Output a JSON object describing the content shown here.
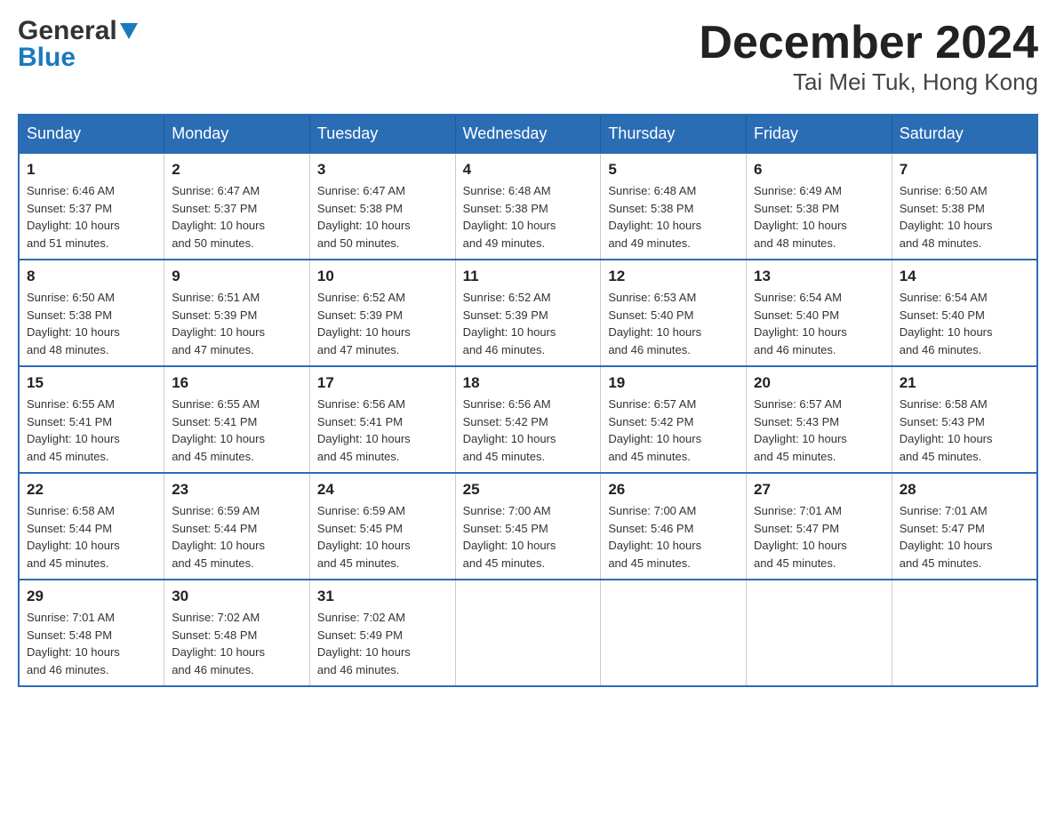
{
  "header": {
    "logo_general": "General",
    "logo_blue": "Blue",
    "month_title": "December 2024",
    "location": "Tai Mei Tuk, Hong Kong"
  },
  "calendar": {
    "days_of_week": [
      "Sunday",
      "Monday",
      "Tuesday",
      "Wednesday",
      "Thursday",
      "Friday",
      "Saturday"
    ],
    "weeks": [
      [
        {
          "day": "1",
          "sunrise": "6:46 AM",
          "sunset": "5:37 PM",
          "daylight": "10 hours and 51 minutes."
        },
        {
          "day": "2",
          "sunrise": "6:47 AM",
          "sunset": "5:37 PM",
          "daylight": "10 hours and 50 minutes."
        },
        {
          "day": "3",
          "sunrise": "6:47 AM",
          "sunset": "5:38 PM",
          "daylight": "10 hours and 50 minutes."
        },
        {
          "day": "4",
          "sunrise": "6:48 AM",
          "sunset": "5:38 PM",
          "daylight": "10 hours and 49 minutes."
        },
        {
          "day": "5",
          "sunrise": "6:48 AM",
          "sunset": "5:38 PM",
          "daylight": "10 hours and 49 minutes."
        },
        {
          "day": "6",
          "sunrise": "6:49 AM",
          "sunset": "5:38 PM",
          "daylight": "10 hours and 48 minutes."
        },
        {
          "day": "7",
          "sunrise": "6:50 AM",
          "sunset": "5:38 PM",
          "daylight": "10 hours and 48 minutes."
        }
      ],
      [
        {
          "day": "8",
          "sunrise": "6:50 AM",
          "sunset": "5:38 PM",
          "daylight": "10 hours and 48 minutes."
        },
        {
          "day": "9",
          "sunrise": "6:51 AM",
          "sunset": "5:39 PM",
          "daylight": "10 hours and 47 minutes."
        },
        {
          "day": "10",
          "sunrise": "6:52 AM",
          "sunset": "5:39 PM",
          "daylight": "10 hours and 47 minutes."
        },
        {
          "day": "11",
          "sunrise": "6:52 AM",
          "sunset": "5:39 PM",
          "daylight": "10 hours and 46 minutes."
        },
        {
          "day": "12",
          "sunrise": "6:53 AM",
          "sunset": "5:40 PM",
          "daylight": "10 hours and 46 minutes."
        },
        {
          "day": "13",
          "sunrise": "6:54 AM",
          "sunset": "5:40 PM",
          "daylight": "10 hours and 46 minutes."
        },
        {
          "day": "14",
          "sunrise": "6:54 AM",
          "sunset": "5:40 PM",
          "daylight": "10 hours and 46 minutes."
        }
      ],
      [
        {
          "day": "15",
          "sunrise": "6:55 AM",
          "sunset": "5:41 PM",
          "daylight": "10 hours and 45 minutes."
        },
        {
          "day": "16",
          "sunrise": "6:55 AM",
          "sunset": "5:41 PM",
          "daylight": "10 hours and 45 minutes."
        },
        {
          "day": "17",
          "sunrise": "6:56 AM",
          "sunset": "5:41 PM",
          "daylight": "10 hours and 45 minutes."
        },
        {
          "day": "18",
          "sunrise": "6:56 AM",
          "sunset": "5:42 PM",
          "daylight": "10 hours and 45 minutes."
        },
        {
          "day": "19",
          "sunrise": "6:57 AM",
          "sunset": "5:42 PM",
          "daylight": "10 hours and 45 minutes."
        },
        {
          "day": "20",
          "sunrise": "6:57 AM",
          "sunset": "5:43 PM",
          "daylight": "10 hours and 45 minutes."
        },
        {
          "day": "21",
          "sunrise": "6:58 AM",
          "sunset": "5:43 PM",
          "daylight": "10 hours and 45 minutes."
        }
      ],
      [
        {
          "day": "22",
          "sunrise": "6:58 AM",
          "sunset": "5:44 PM",
          "daylight": "10 hours and 45 minutes."
        },
        {
          "day": "23",
          "sunrise": "6:59 AM",
          "sunset": "5:44 PM",
          "daylight": "10 hours and 45 minutes."
        },
        {
          "day": "24",
          "sunrise": "6:59 AM",
          "sunset": "5:45 PM",
          "daylight": "10 hours and 45 minutes."
        },
        {
          "day": "25",
          "sunrise": "7:00 AM",
          "sunset": "5:45 PM",
          "daylight": "10 hours and 45 minutes."
        },
        {
          "day": "26",
          "sunrise": "7:00 AM",
          "sunset": "5:46 PM",
          "daylight": "10 hours and 45 minutes."
        },
        {
          "day": "27",
          "sunrise": "7:01 AM",
          "sunset": "5:47 PM",
          "daylight": "10 hours and 45 minutes."
        },
        {
          "day": "28",
          "sunrise": "7:01 AM",
          "sunset": "5:47 PM",
          "daylight": "10 hours and 45 minutes."
        }
      ],
      [
        {
          "day": "29",
          "sunrise": "7:01 AM",
          "sunset": "5:48 PM",
          "daylight": "10 hours and 46 minutes."
        },
        {
          "day": "30",
          "sunrise": "7:02 AM",
          "sunset": "5:48 PM",
          "daylight": "10 hours and 46 minutes."
        },
        {
          "day": "31",
          "sunrise": "7:02 AM",
          "sunset": "5:49 PM",
          "daylight": "10 hours and 46 minutes."
        },
        null,
        null,
        null,
        null
      ]
    ],
    "sunrise_label": "Sunrise:",
    "sunset_label": "Sunset:",
    "daylight_label": "Daylight:"
  }
}
